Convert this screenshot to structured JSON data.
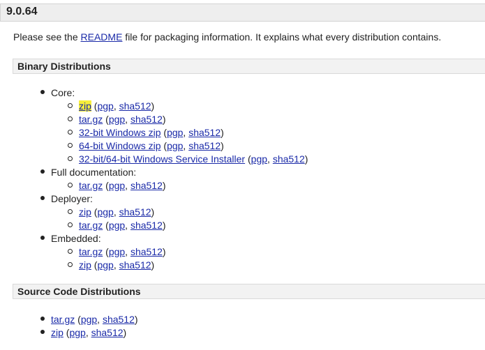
{
  "version": "9.0.64",
  "intro": {
    "before": "Please see the ",
    "link": "README",
    "after": " file for packaging information. It explains what every distribution contains."
  },
  "binary": {
    "title": "Binary Distributions",
    "core_label": "Core:",
    "full_doc_label": "Full documentation:",
    "deployer_label": "Deployer:",
    "embedded_label": "Embedded:"
  },
  "source": {
    "title": "Source Code Distributions"
  },
  "links": {
    "zip": "zip",
    "targz": "tar.gz",
    "win32": "32-bit Windows zip",
    "win64": "64-bit Windows zip",
    "installer": "32-bit/64-bit Windows Service Installer",
    "pgp": "pgp",
    "sha512": "sha512",
    "open": " (",
    "comma": ", ",
    "close": ")"
  }
}
